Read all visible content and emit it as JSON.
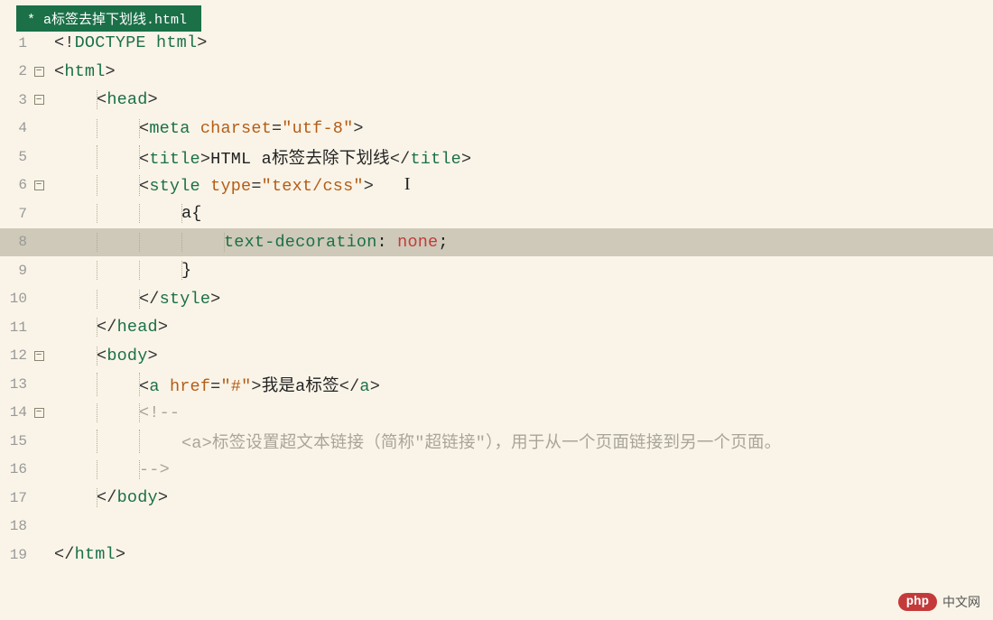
{
  "tab": {
    "title": "* a标签去掉下划线.html"
  },
  "code": {
    "lines": [
      {
        "num": "1",
        "fold": null,
        "indent": 0,
        "guides": [],
        "tokens": [
          {
            "c": "t-bracket",
            "t": "<!"
          },
          {
            "c": "t-tag",
            "t": "DOCTYPE"
          },
          {
            "c": "t-text",
            "t": " "
          },
          {
            "c": "t-tag",
            "t": "html"
          },
          {
            "c": "t-bracket",
            "t": ">"
          }
        ]
      },
      {
        "num": "2",
        "fold": "minus",
        "indent": 0,
        "guides": [],
        "tokens": [
          {
            "c": "t-bracket",
            "t": "<"
          },
          {
            "c": "t-tag",
            "t": "html"
          },
          {
            "c": "t-bracket",
            "t": ">"
          }
        ]
      },
      {
        "num": "3",
        "fold": "minus",
        "indent": 1,
        "guides": [
          0
        ],
        "tokens": [
          {
            "c": "t-bracket",
            "t": "<"
          },
          {
            "c": "t-tag",
            "t": "head"
          },
          {
            "c": "t-bracket",
            "t": ">"
          }
        ]
      },
      {
        "num": "4",
        "fold": null,
        "indent": 2,
        "guides": [
          0,
          1
        ],
        "tokens": [
          {
            "c": "t-bracket",
            "t": "<"
          },
          {
            "c": "t-tag",
            "t": "meta"
          },
          {
            "c": "t-text",
            "t": " "
          },
          {
            "c": "t-attr",
            "t": "charset"
          },
          {
            "c": "t-op",
            "t": "="
          },
          {
            "c": "t-str",
            "t": "\"utf-8\""
          },
          {
            "c": "t-bracket",
            "t": ">"
          }
        ]
      },
      {
        "num": "5",
        "fold": null,
        "indent": 2,
        "guides": [
          0,
          1
        ],
        "tokens": [
          {
            "c": "t-bracket",
            "t": "<"
          },
          {
            "c": "t-tag",
            "t": "title"
          },
          {
            "c": "t-bracket",
            "t": ">"
          },
          {
            "c": "t-text",
            "t": "HTML a标签去除下划线"
          },
          {
            "c": "t-bracket",
            "t": "</"
          },
          {
            "c": "t-tag",
            "t": "title"
          },
          {
            "c": "t-bracket",
            "t": ">"
          }
        ]
      },
      {
        "num": "6",
        "fold": "minus",
        "indent": 2,
        "guides": [
          0,
          1
        ],
        "tokens": [
          {
            "c": "t-bracket",
            "t": "<"
          },
          {
            "c": "t-tag",
            "t": "style"
          },
          {
            "c": "t-text",
            "t": " "
          },
          {
            "c": "t-attr",
            "t": "type"
          },
          {
            "c": "t-op",
            "t": "="
          },
          {
            "c": "t-str",
            "t": "\"text/css\""
          },
          {
            "c": "t-bracket",
            "t": ">"
          }
        ],
        "cursor": true
      },
      {
        "num": "7",
        "fold": null,
        "indent": 3,
        "guides": [
          0,
          1,
          2
        ],
        "tokens": [
          {
            "c": "t-text",
            "t": "a{"
          }
        ]
      },
      {
        "num": "8",
        "fold": null,
        "indent": 4,
        "guides": [
          0,
          1,
          2,
          3
        ],
        "highlighted": true,
        "tokens": [
          {
            "c": "t-css-prop",
            "t": "text-decoration"
          },
          {
            "c": "t-text",
            "t": ": "
          },
          {
            "c": "t-css-val",
            "t": "none"
          },
          {
            "c": "t-text",
            "t": ";"
          }
        ]
      },
      {
        "num": "9",
        "fold": null,
        "indent": 3,
        "guides": [
          0,
          1,
          2
        ],
        "tokens": [
          {
            "c": "t-text",
            "t": "}"
          }
        ]
      },
      {
        "num": "10",
        "fold": null,
        "indent": 2,
        "guides": [
          0,
          1
        ],
        "tokens": [
          {
            "c": "t-bracket",
            "t": "</"
          },
          {
            "c": "t-tag",
            "t": "style"
          },
          {
            "c": "t-bracket",
            "t": ">"
          }
        ]
      },
      {
        "num": "11",
        "fold": null,
        "indent": 1,
        "guides": [
          0
        ],
        "tokens": [
          {
            "c": "t-bracket",
            "t": "</"
          },
          {
            "c": "t-tag",
            "t": "head"
          },
          {
            "c": "t-bracket",
            "t": ">"
          }
        ]
      },
      {
        "num": "12",
        "fold": "minus",
        "indent": 1,
        "guides": [
          0
        ],
        "tokens": [
          {
            "c": "t-bracket",
            "t": "<"
          },
          {
            "c": "t-tag",
            "t": "body"
          },
          {
            "c": "t-bracket",
            "t": ">"
          }
        ]
      },
      {
        "num": "13",
        "fold": null,
        "indent": 2,
        "guides": [
          0,
          1
        ],
        "tokens": [
          {
            "c": "t-bracket",
            "t": "<"
          },
          {
            "c": "t-tag",
            "t": "a"
          },
          {
            "c": "t-text",
            "t": " "
          },
          {
            "c": "t-attr",
            "t": "href"
          },
          {
            "c": "t-op",
            "t": "="
          },
          {
            "c": "t-str",
            "t": "\"#\""
          },
          {
            "c": "t-bracket",
            "t": ">"
          },
          {
            "c": "t-text",
            "t": "我是a标签"
          },
          {
            "c": "t-bracket",
            "t": "</"
          },
          {
            "c": "t-tag",
            "t": "a"
          },
          {
            "c": "t-bracket",
            "t": ">"
          }
        ]
      },
      {
        "num": "14",
        "fold": "minus",
        "indent": 2,
        "guides": [
          0,
          1
        ],
        "tokens": [
          {
            "c": "t-comment",
            "t": "<!--"
          }
        ]
      },
      {
        "num": "15",
        "fold": null,
        "indent": 3,
        "guides": [
          0,
          1
        ],
        "tokens": [
          {
            "c": "t-comment",
            "t": "<a>标签设置超文本链接（简称\"超链接\"），用于从一个页面链接到另一个页面。"
          }
        ]
      },
      {
        "num": "16",
        "fold": null,
        "indent": 2,
        "guides": [
          0,
          1
        ],
        "tokens": [
          {
            "c": "t-comment",
            "t": "-->"
          }
        ]
      },
      {
        "num": "17",
        "fold": null,
        "indent": 1,
        "guides": [
          0
        ],
        "tokens": [
          {
            "c": "t-bracket",
            "t": "</"
          },
          {
            "c": "t-tag",
            "t": "body"
          },
          {
            "c": "t-bracket",
            "t": ">"
          }
        ]
      },
      {
        "num": "18",
        "fold": null,
        "indent": 0,
        "guides": [],
        "tokens": []
      },
      {
        "num": "19",
        "fold": null,
        "indent": 0,
        "guides": [],
        "tokens": [
          {
            "c": "t-bracket",
            "t": "</"
          },
          {
            "c": "t-tag",
            "t": "html"
          },
          {
            "c": "t-bracket",
            "t": ">"
          }
        ]
      }
    ]
  },
  "watermark": {
    "badge": "php",
    "text": "中文网"
  }
}
